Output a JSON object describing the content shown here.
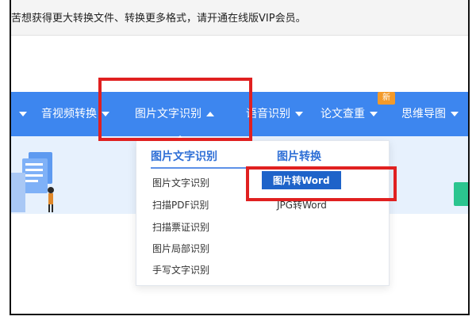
{
  "notice": {
    "text": "苦想获得更大转换文件、转换更多格式，请开通在线版VIP会员。"
  },
  "nav": {
    "items": [
      {
        "label": "音视频转换",
        "caret": "down"
      },
      {
        "label": "图片文字识别",
        "caret": "up"
      },
      {
        "label": "语音识别",
        "caret": "down"
      },
      {
        "label": "论文查重",
        "caret": "down",
        "badge": "新"
      },
      {
        "label": "思维导图",
        "caret": "down"
      }
    ]
  },
  "dropdown": {
    "left_heading": "图片文字识别",
    "right_heading": "图片转换",
    "left_items": [
      "图片文字识别",
      "扫描PDF识别",
      "扫描票证识别",
      "图片局部识别",
      "手写文字识别"
    ],
    "right_items": [
      "图片转Word",
      "JPG转Word"
    ]
  },
  "colors": {
    "nav_bg": "#3d86ef",
    "accent": "#2f6fd6",
    "highlight": "#1e63c9",
    "annotation": "#e02020",
    "badge": "#f39a2a"
  },
  "icons": [
    "caret-down-icon",
    "caret-up-icon",
    "document-illustration-icon"
  ]
}
